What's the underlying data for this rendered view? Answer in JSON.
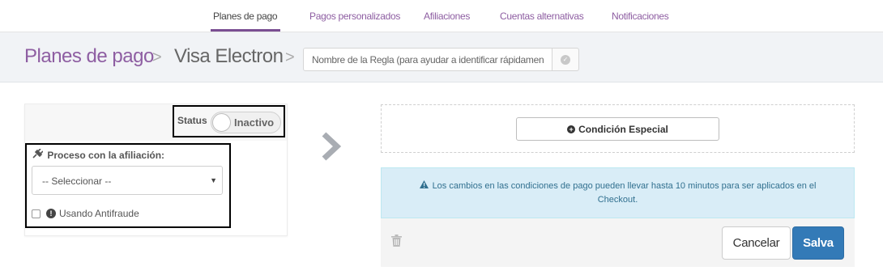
{
  "nav": {
    "tabs": [
      {
        "label": "Planes de pago",
        "active": true
      },
      {
        "label": "Pagos personalizados",
        "active": false
      },
      {
        "label": "Afiliaciones",
        "active": false
      },
      {
        "label": "Cuentas alternativas",
        "active": false
      },
      {
        "label": "Notificaciones",
        "active": false
      }
    ]
  },
  "header": {
    "breadcrumb_root": "Planes de pago",
    "breadcrumb_current": "Visa Electron",
    "separator": ">",
    "rule_placeholder": "Nombre de la Regla (para ayudar a identificar rápidamente)",
    "confirm_icon": "check-circle-icon"
  },
  "rule": {
    "status_label": "Status",
    "status_value": "Inactivo",
    "process_label": "Proceso con la afiliación:",
    "process_icon": "plug-icon",
    "process_selected": "-- Seleccionar --",
    "antifraud_label": "Usando Antifraude",
    "antifraud_checked": false
  },
  "conditions": {
    "special_button": "Condición Especial",
    "alert_text": "Los cambios en las condiciones de pago pueden llevar hasta 10 minutos para ser aplicados en el Checkout."
  },
  "actions": {
    "cancel_label": "Cancelar",
    "save_label": "Salva"
  },
  "colors": {
    "brand_purple": "#8e5ea2",
    "primary_blue": "#337ab7",
    "alert_bg": "#d9edf7"
  }
}
